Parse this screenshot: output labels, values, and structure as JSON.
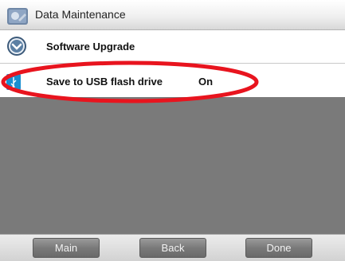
{
  "title": {
    "text": "Data Maintenance",
    "icon": "data-maintenance-icon"
  },
  "rows": [
    {
      "label": "Software Upgrade",
      "icon": "upgrade-icon"
    },
    {
      "label": "Save to USB flash drive",
      "value": "On",
      "icon": "usb-icon"
    }
  ],
  "footer": {
    "main_label": "Main",
    "back_label": "Back",
    "done_label": "Done"
  },
  "annotation": {
    "color": "#e8141e",
    "shape": "ellipse"
  },
  "colors": {
    "panel": "#7a7a7a",
    "usb_icon": "#1a8fd0"
  }
}
